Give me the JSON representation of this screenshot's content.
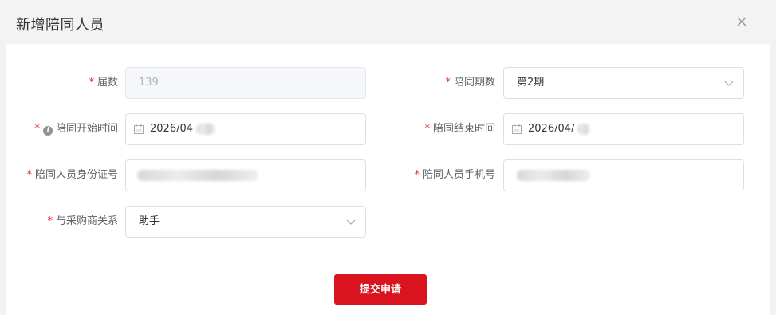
{
  "dialog": {
    "title": "新增陪同人员"
  },
  "form": {
    "session_count": {
      "label": "届数",
      "value": "139",
      "required": true,
      "disabled": true
    },
    "accompany_period": {
      "label": "陪同期数",
      "value": "第2期",
      "required": true
    },
    "start_time": {
      "label": "陪同开始时间",
      "value": "2026/04",
      "required": true,
      "has_info_icon": true
    },
    "end_time": {
      "label": "陪同结束时间",
      "value": "2026/04/",
      "required": true
    },
    "id_number": {
      "label": "陪同人员身份证号",
      "value": "",
      "required": true,
      "redacted": true
    },
    "phone": {
      "label": "陪同人员手机号",
      "value": "",
      "required": true,
      "redacted": true
    },
    "relation": {
      "label": "与采购商关系",
      "value": "助手",
      "required": true
    }
  },
  "actions": {
    "submit_label": "提交申请"
  },
  "colors": {
    "primary": "#d9141e",
    "required_star": "#e22a2a",
    "disabled_bg": "#f5f7fa"
  },
  "icons": [
    "close-icon",
    "info-icon",
    "calendar-icon",
    "chevron-down-icon"
  ]
}
